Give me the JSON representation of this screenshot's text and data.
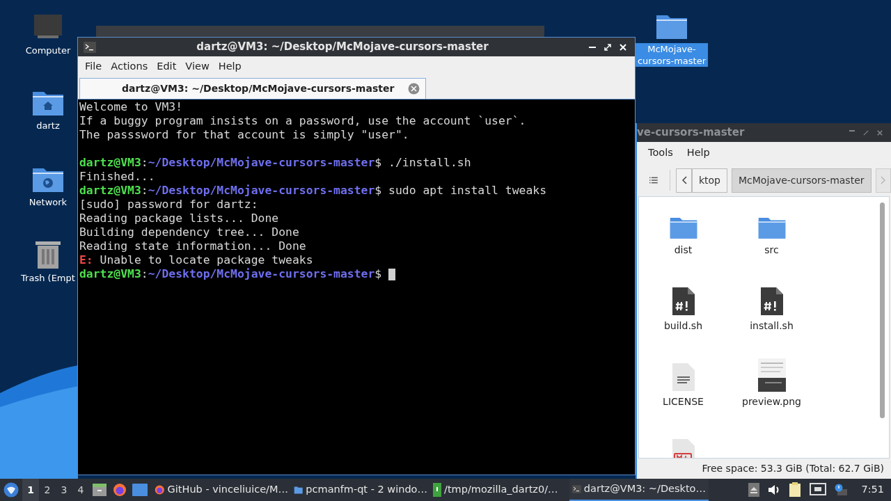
{
  "desktop_icons": [
    {
      "label": "Computer",
      "kind": "computer",
      "selected": false
    },
    {
      "label": "dartz",
      "kind": "home",
      "selected": false
    },
    {
      "label": "Network",
      "kind": "network",
      "selected": false
    },
    {
      "label": "Trash (Empt",
      "kind": "trash",
      "selected": false
    },
    {
      "label": "McMojave-cursors-master",
      "kind": "folder",
      "selected": true
    }
  ],
  "terminal": {
    "title": "dartz@VM3: ~/Desktop/McMojave-cursors-master",
    "menu": [
      "File",
      "Actions",
      "Edit",
      "View",
      "Help"
    ],
    "tab": {
      "label": "dartz@VM3: ~/Desktop/McMojave-cursors-master",
      "selected": true
    },
    "lines": [
      [
        {
          "kind": "text",
          "text": "Welcome to VM3!"
        }
      ],
      [
        {
          "kind": "text",
          "text": "If a buggy program insists on a password, use the account `user`."
        }
      ],
      [
        {
          "kind": "text",
          "text": "The passsword for that account is simply \"user\"."
        }
      ],
      [
        {
          "kind": "blank"
        }
      ],
      [
        {
          "kind": "user",
          "text": "dartz@VM3"
        },
        {
          "kind": "text",
          "text": ":"
        },
        {
          "kind": "path",
          "text": "~/Desktop/McMojave-cursors-master"
        },
        {
          "kind": "text",
          "text": "$ ./install.sh"
        }
      ],
      [
        {
          "kind": "text",
          "text": "Finished..."
        }
      ],
      [
        {
          "kind": "user",
          "text": "dartz@VM3"
        },
        {
          "kind": "text",
          "text": ":"
        },
        {
          "kind": "path",
          "text": "~/Desktop/McMojave-cursors-master"
        },
        {
          "kind": "text",
          "text": "$ sudo apt install tweaks"
        }
      ],
      [
        {
          "kind": "text",
          "text": "[sudo] password for dartz:"
        }
      ],
      [
        {
          "kind": "text",
          "text": "Reading package lists... Done"
        }
      ],
      [
        {
          "kind": "text",
          "text": "Building dependency tree... Done"
        }
      ],
      [
        {
          "kind": "text",
          "text": "Reading state information... Done"
        }
      ],
      [
        {
          "kind": "error",
          "text": "E:"
        },
        {
          "kind": "text",
          "text": " Unable to locate package tweaks"
        }
      ],
      [
        {
          "kind": "user",
          "text": "dartz@VM3"
        },
        {
          "kind": "text",
          "text": ":"
        },
        {
          "kind": "path",
          "text": "~/Desktop/McMojave-cursors-master"
        },
        {
          "kind": "text",
          "text": "$ "
        },
        {
          "kind": "cursor"
        }
      ]
    ]
  },
  "file_manager": {
    "title": "ve-cursors-master",
    "menu": [
      "Tools",
      "Help"
    ],
    "breadcrumbs": [
      {
        "label": "ktop",
        "selected": false
      },
      {
        "label": "McMojave-cursors-master",
        "selected": true
      }
    ],
    "forward_disabled": true,
    "files": [
      {
        "label": "dist",
        "kind": "folder"
      },
      {
        "label": "src",
        "kind": "folder"
      },
      {
        "label": "build.sh",
        "kind": "script"
      },
      {
        "label": "install.sh",
        "kind": "script"
      },
      {
        "label": "LICENSE",
        "kind": "text"
      },
      {
        "label": "preview.png"
      },
      {
        "kind": "markdown"
      }
    ],
    "status": "Free space: 53.3 GiB (Total: 62.7 GiB)"
  },
  "taskbar": {
    "desktops": [
      {
        "label": "1",
        "selected": true
      },
      {
        "label": "2",
        "selected": false
      },
      {
        "label": "3",
        "selected": false
      },
      {
        "label": "4",
        "selected": false
      }
    ],
    "launchers": [
      {
        "kind": "files"
      },
      {
        "kind": "firefox"
      },
      {
        "kind": "desktop"
      }
    ],
    "tasks": [
      {
        "label": "GitHub - vinceliuice/M…",
        "kind": "firefox",
        "selected": false
      },
      {
        "label": "pcmanfm-qt - 2 windo…",
        "kind": "folder",
        "selected": false
      },
      {
        "label": "/tmp/mozilla_dartz0/…",
        "kind": "archive",
        "selected": false
      },
      {
        "label": "dartz@VM3: ~/Deskto…",
        "kind": "terminal",
        "selected": true
      }
    ],
    "clock": "7:51"
  }
}
